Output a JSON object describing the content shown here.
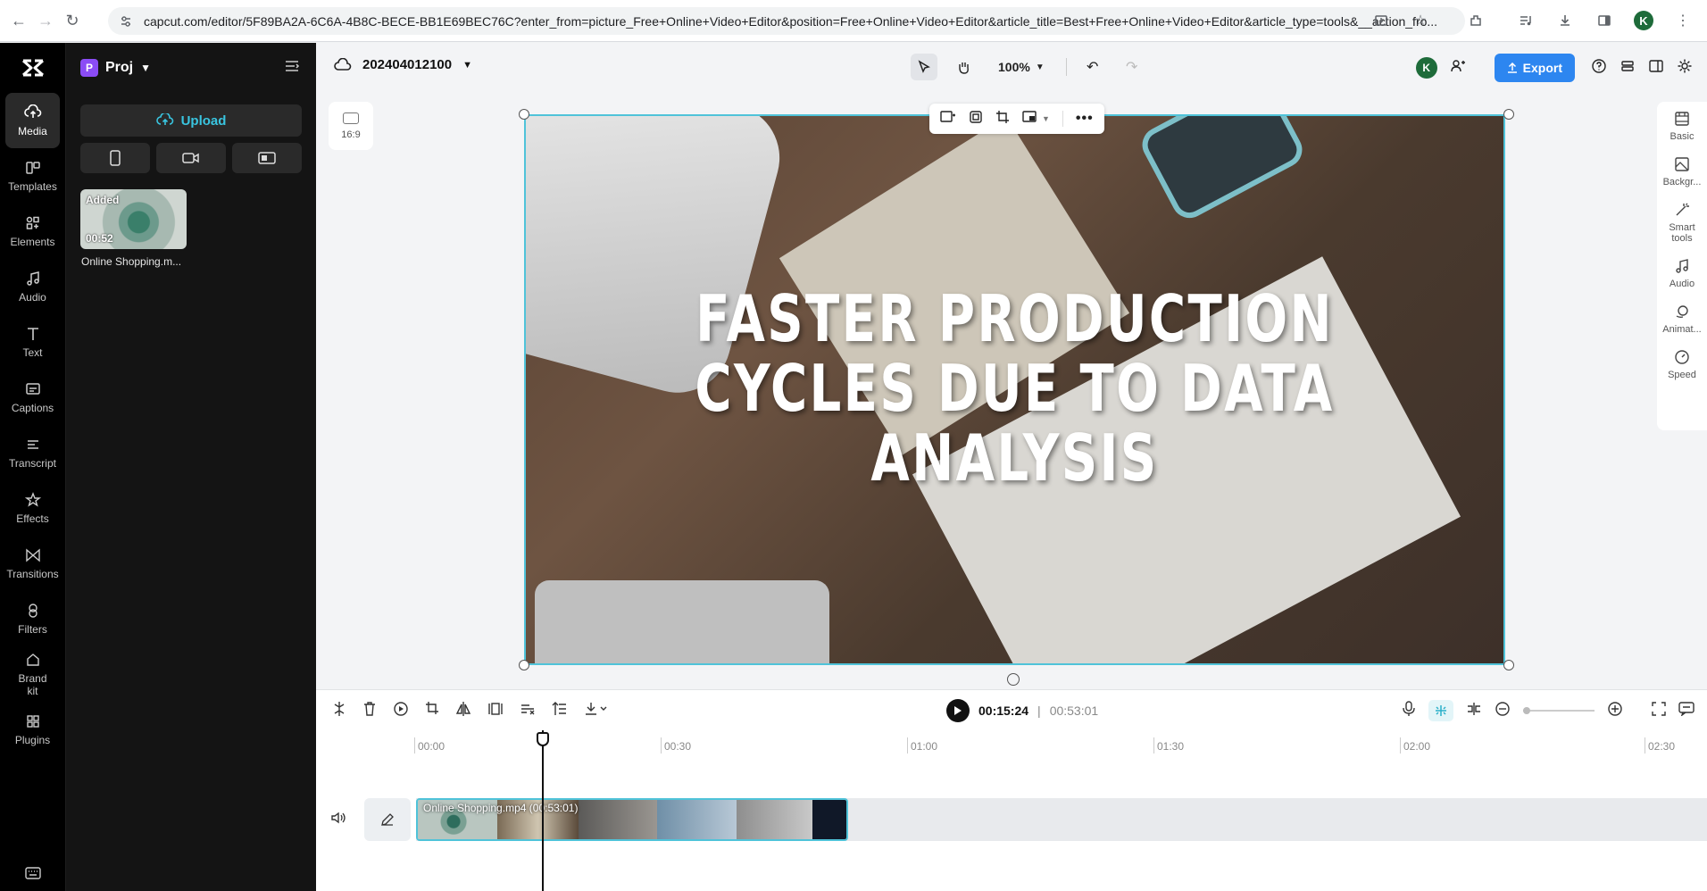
{
  "browser": {
    "url": "capcut.com/editor/5F89BA2A-6C6A-4B8C-BECE-BB1E69BEC76C?enter_from=picture_Free+Online+Video+Editor&position=Free+Online+Video+Editor&article_title=Best+Free+Online+Video+Editor&article_type=tools&__action_fro...",
    "profile_initial": "K"
  },
  "nav": {
    "items": [
      {
        "label": "Media",
        "icon": "cloud-upload-icon"
      },
      {
        "label": "Templates",
        "icon": "templates-icon"
      },
      {
        "label": "Elements",
        "icon": "elements-icon"
      },
      {
        "label": "Audio",
        "icon": "music-note-icon"
      },
      {
        "label": "Text",
        "icon": "text-icon"
      },
      {
        "label": "Captions",
        "icon": "captions-icon"
      },
      {
        "label": "Transcript",
        "icon": "transcript-icon"
      },
      {
        "label": "Effects",
        "icon": "effects-star-icon"
      },
      {
        "label": "Transitions",
        "icon": "transitions-icon"
      },
      {
        "label": "Filters",
        "icon": "filters-icon"
      },
      {
        "label": "Brand kit",
        "icon": "brand-kit-icon"
      },
      {
        "label": "Plugins",
        "icon": "plugins-grid-icon"
      }
    ]
  },
  "panel": {
    "project_badge": "P",
    "project_label": "Proj",
    "upload_label": "Upload",
    "media_item": {
      "badge": "Added",
      "duration": "00:52",
      "name": "Online Shopping.m..."
    }
  },
  "editor": {
    "project_title": "202404012100",
    "zoom": "100%",
    "collaborator_initial": "K",
    "export_label": "Export",
    "aspect_ratio": "16:9",
    "caption_lines": [
      "FASTER PRODUCTION",
      "CYCLES DUE TO DATA",
      "ANALYSIS"
    ]
  },
  "right_panel": {
    "items": [
      {
        "label": "Basic"
      },
      {
        "label": "Backgr..."
      },
      {
        "label": "Smart tools"
      },
      {
        "label": "Audio"
      },
      {
        "label": "Animat..."
      },
      {
        "label": "Speed"
      }
    ]
  },
  "timeline": {
    "current_time": "00:15:24",
    "separator": "|",
    "total_time": "00:53:01",
    "ruler": [
      "00:00",
      "00:30",
      "01:00",
      "01:30",
      "02:00",
      "02:30"
    ],
    "clip_label": "Online Shopping.mp4",
    "clip_duration": "00:53:01"
  },
  "colors": {
    "accent": "#4fc3d9",
    "export": "#2d86f0",
    "nav_bg": "#000000",
    "panel_bg": "#141414"
  }
}
